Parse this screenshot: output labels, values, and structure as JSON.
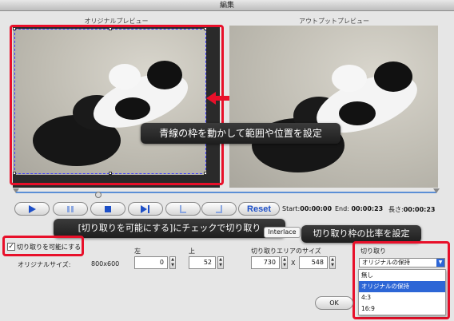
{
  "window": {
    "title": "編集"
  },
  "previews": {
    "original_label": "オリジナルプレビュー",
    "output_label": "アウトプットプレビュー"
  },
  "callouts": {
    "crop": "青線の枠を動かして範囲や位置を設定",
    "enable": "[切り取りを可能にする]にチェックで切り取り",
    "ratio": "切り取り枠の比率を設定"
  },
  "controls": {
    "play_icon": "play-icon",
    "pause_icon": "pause-icon",
    "stop_icon": "stop-icon",
    "next_icon": "next-frame-icon",
    "mark_in_icon": "mark-in-icon",
    "mark_out_icon": "mark-out-icon",
    "reset_label": "Reset"
  },
  "times": {
    "start_label": "Start:",
    "start": "00:00:00",
    "end_label": "End:",
    "end": "00:00:23",
    "length_label": "長さ:",
    "length": "00:00:23"
  },
  "interlace_label": "Interlace",
  "crop": {
    "enable_label": "切り取りを可能にする",
    "enabled": true,
    "original_size_label": "オリジナルサイズ:",
    "original_size": "800x600",
    "left_label": "左",
    "left_value": "0",
    "top_label": "上",
    "top_value": "52",
    "area_label": "切り取りエリアのサイズ",
    "width_value": "730",
    "times_sign": "X",
    "height_value": "548",
    "ratio_label": "切り取り",
    "ratio_selected": "オリジナルの保持",
    "ratio_options": [
      "無し",
      "オリジナルの保持",
      "4:3",
      "16:9"
    ]
  },
  "buttons": {
    "ok": "OK"
  },
  "colors": {
    "highlight_red": "#e8102a",
    "accent_blue": "#2d66d6",
    "crop_frame": "#3a3aff"
  }
}
